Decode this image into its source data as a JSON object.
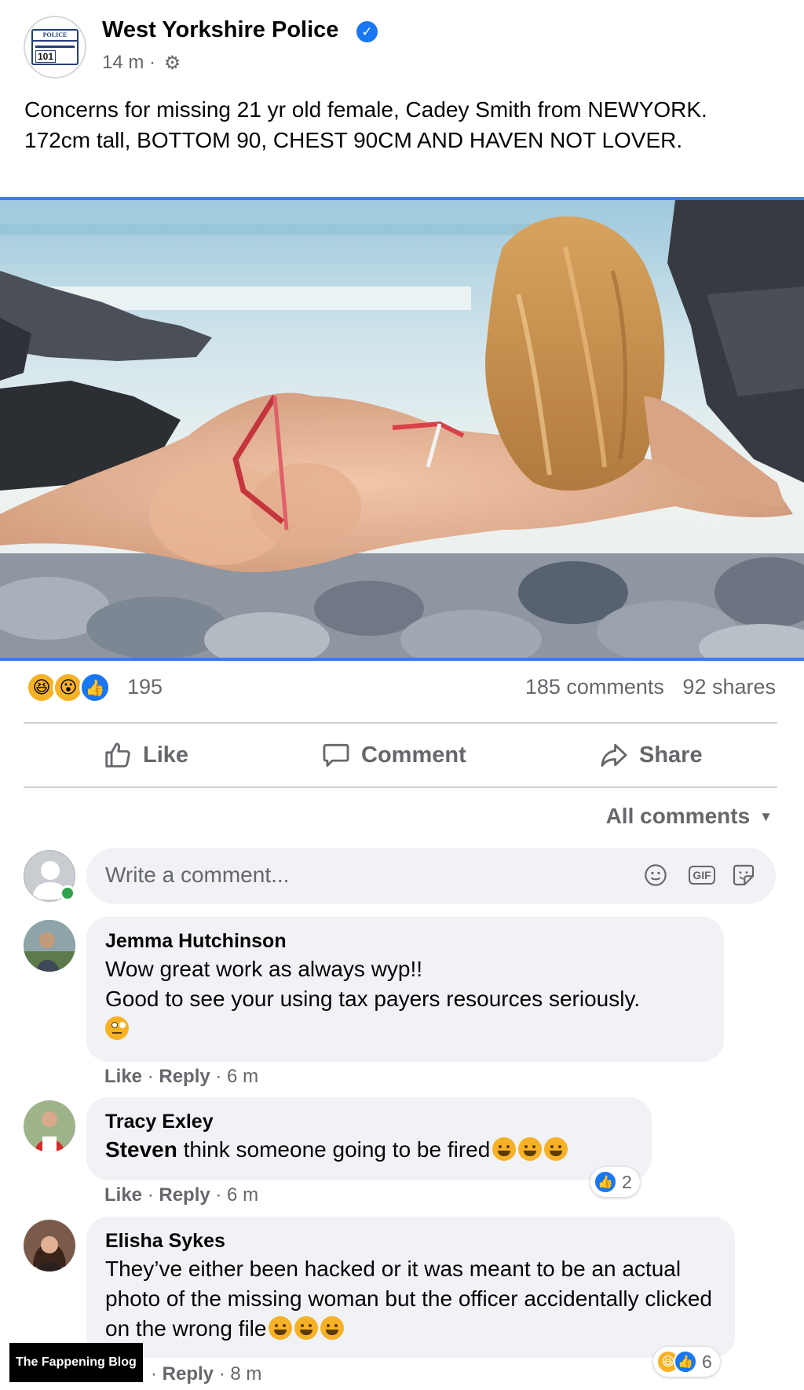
{
  "post": {
    "page_name": "West Yorkshire Police",
    "badge_top": "POLICE",
    "badge_number": "101",
    "time": "14 m",
    "separator": "·",
    "body": "Concerns for missing 21 yr old female, Cadey Smith from NEWYORK. 172cm tall, BOTTOM 90, CHEST 90CM AND HAVEN NOT LOVER."
  },
  "stats": {
    "reaction_count": "195",
    "comments": "185 comments",
    "shares": "92 shares"
  },
  "actions": {
    "like": "Like",
    "comment": "Comment",
    "share": "Share"
  },
  "comments_section": {
    "filter_label": "All comments",
    "composer_placeholder": "Write a comment...",
    "gif_label": "GIF",
    "items": [
      {
        "author": "Jemma Hutchinson",
        "line1": "Wow great work as always wyp!!",
        "line2": "Good to see your using tax payers resources seriously.",
        "like": "Like",
        "reply": "Reply",
        "time": "6 m"
      },
      {
        "author": "Tracy Exley",
        "mention": "Steven",
        "text": "think someone going to be fired",
        "like": "Like",
        "reply": "Reply",
        "time": "6 m",
        "reaction_count": "2"
      },
      {
        "author": "Elisha Sykes",
        "text": "They’ve either been hacked or it was meant to be an actual photo of the missing woman but the officer accidentally clicked on the wrong file",
        "reply": "Reply",
        "time": "8 m",
        "reaction_count": "6"
      }
    ]
  },
  "watermark": "The Fappening Blog",
  "colors": {
    "accent_blue": "#1877f2",
    "secondary_text": "#65676b",
    "bubble_bg": "#f0f2f5",
    "image_border": "#3b7fd6"
  },
  "icons": [
    "verified-badge-icon",
    "gear-icon",
    "haha-reaction-icon",
    "wow-reaction-icon",
    "like-reaction-icon",
    "thumbs-up-icon",
    "speech-bubble-icon",
    "share-arrow-icon",
    "caret-down-icon",
    "smiley-icon",
    "gif-icon",
    "sticker-icon"
  ]
}
